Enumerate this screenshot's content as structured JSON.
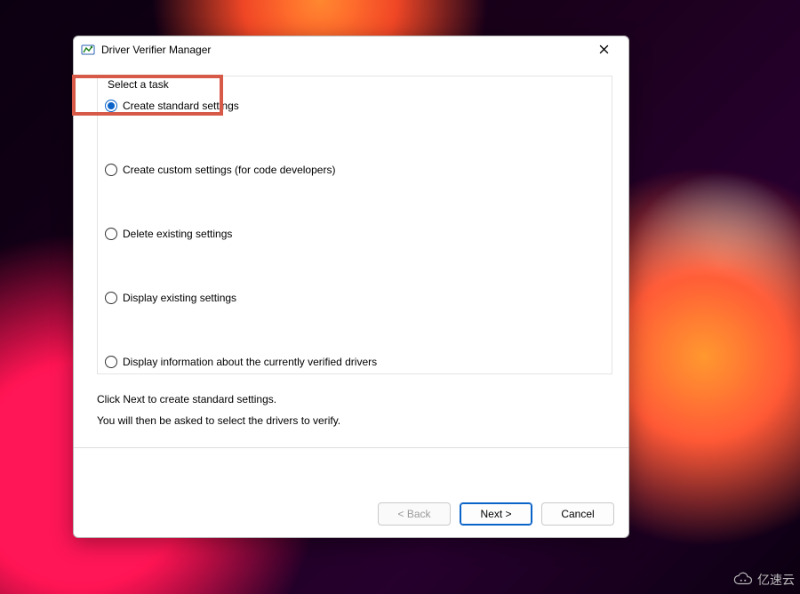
{
  "window": {
    "title": "Driver Verifier Manager",
    "close_label": "Close"
  },
  "group": {
    "label": "Select a task"
  },
  "options": [
    {
      "id": "opt-standard",
      "label": "Create standard settings",
      "checked": true
    },
    {
      "id": "opt-custom",
      "label": "Create custom settings (for code developers)",
      "checked": false
    },
    {
      "id": "opt-delete",
      "label": "Delete existing settings",
      "checked": false
    },
    {
      "id": "opt-display",
      "label": "Display existing settings",
      "checked": false
    },
    {
      "id": "opt-info",
      "label": "Display information about the currently verified drivers",
      "checked": false
    }
  ],
  "hint": {
    "line1": "Click Next to create standard settings.",
    "line2": "You will then be asked to select the drivers to verify."
  },
  "buttons": {
    "back": "< Back",
    "next": "Next >",
    "cancel": "Cancel"
  },
  "highlight": {
    "target_option": "opt-standard",
    "color": "#d65a47"
  },
  "watermark": "亿速云"
}
